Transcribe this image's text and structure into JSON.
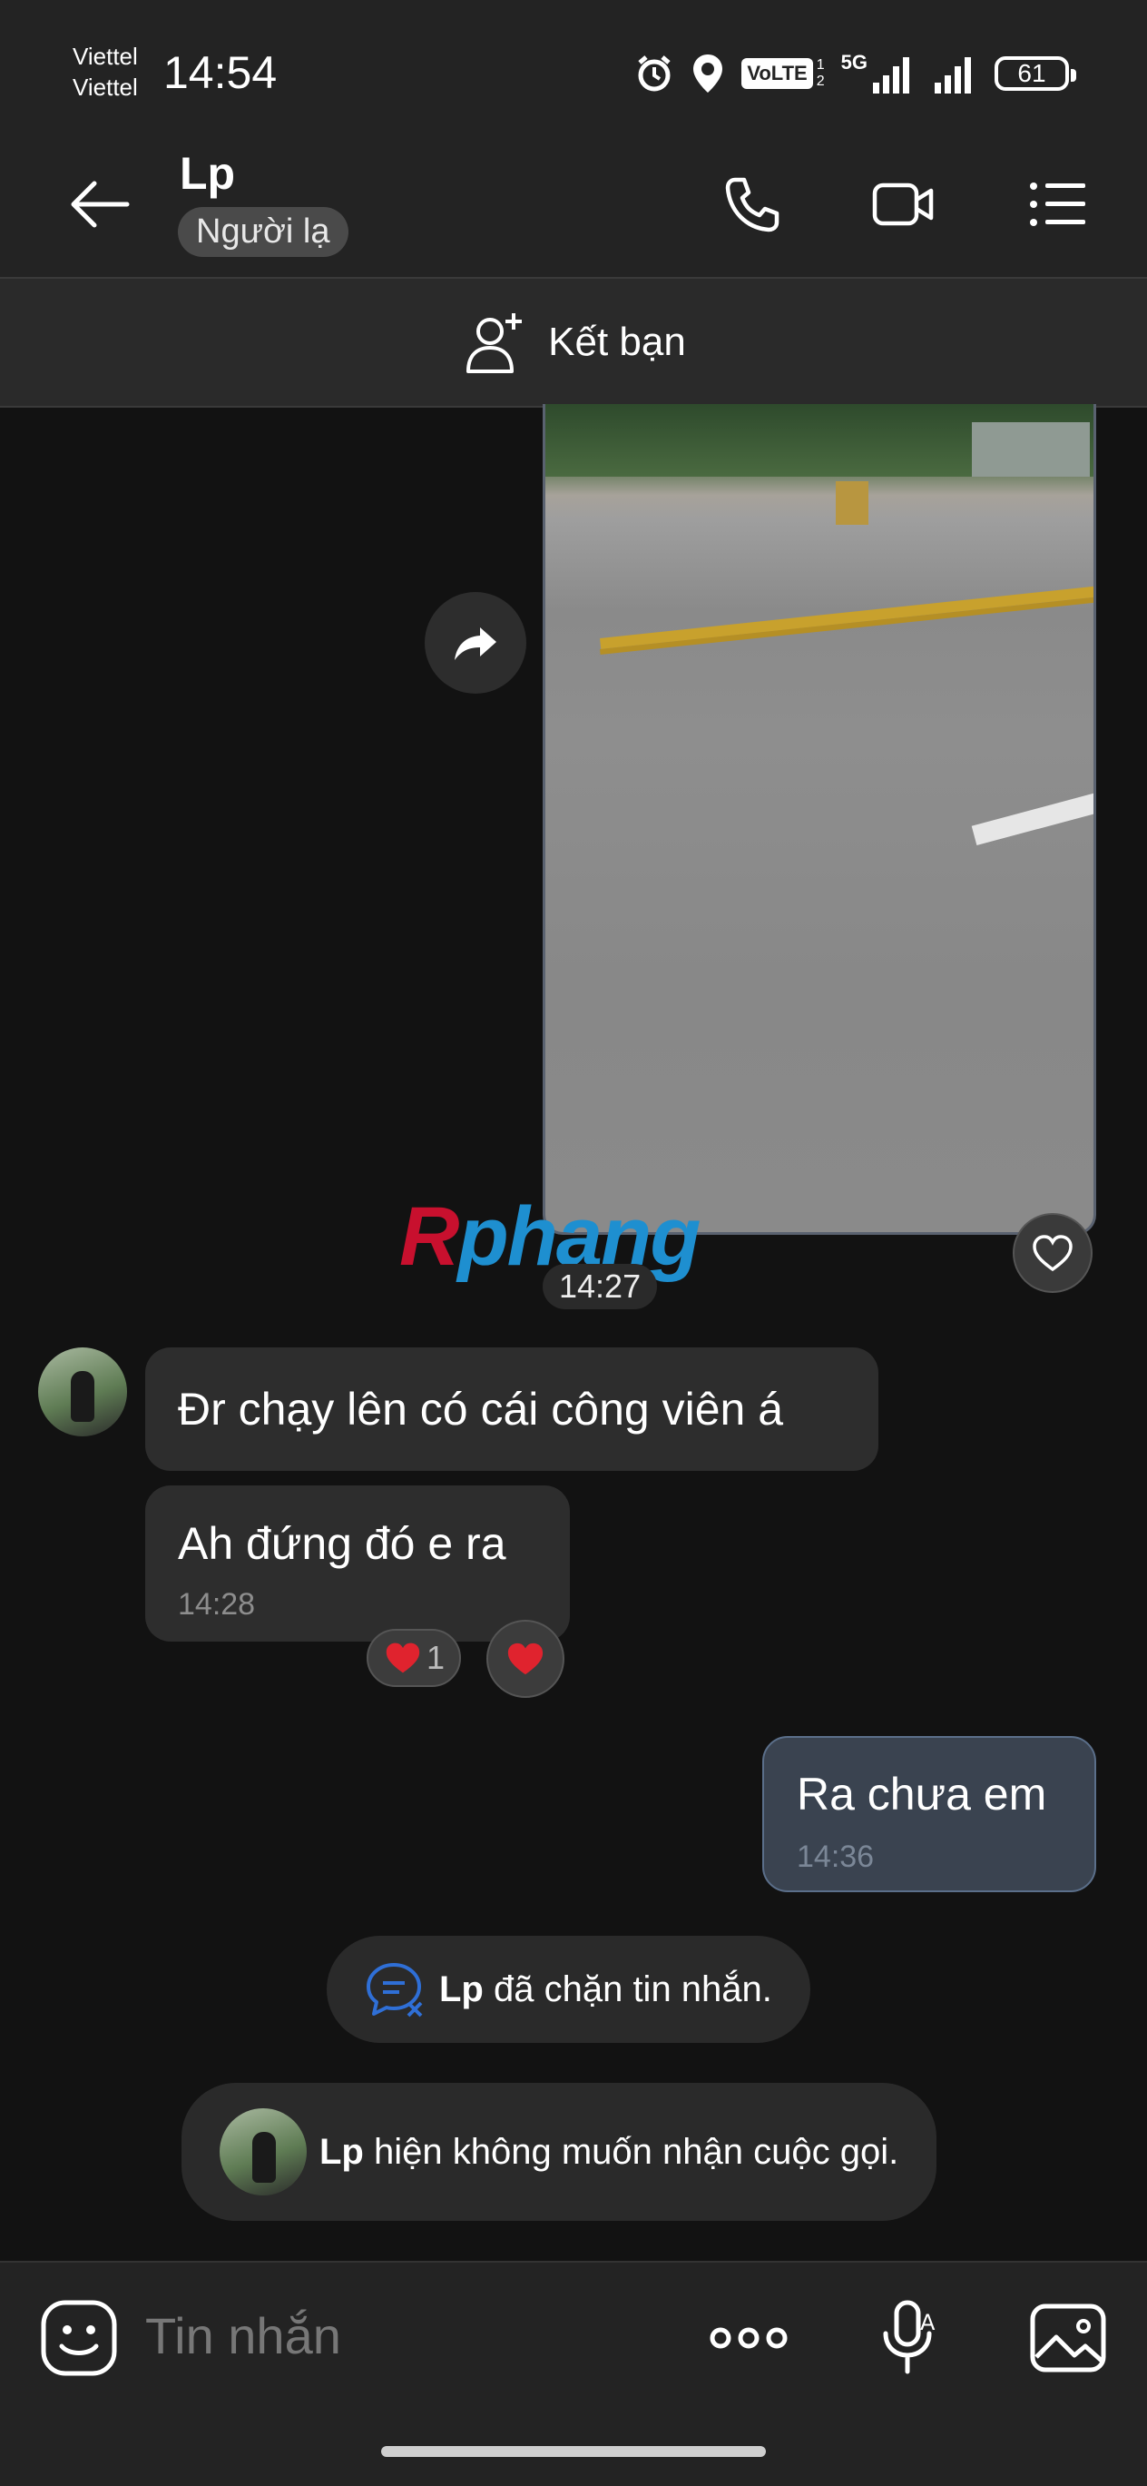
{
  "status_bar": {
    "carrier_1": "Viettel",
    "carrier_2": "Viettel",
    "time": "14:54",
    "network_label": "VoLTE",
    "sim_numbers": [
      "1",
      "2"
    ],
    "network_type": "5G",
    "battery": "61",
    "icons": [
      "alarm-icon",
      "location-icon",
      "signal-icon",
      "battery-icon"
    ]
  },
  "header": {
    "contact_name": "Lp",
    "stranger_badge": "Người lạ",
    "icons": [
      "back-arrow-icon",
      "phone-icon",
      "video-call-icon",
      "menu-list-icon"
    ]
  },
  "friend_bar": {
    "label": "Kết bạn",
    "icon": "add-friend-icon"
  },
  "video_message": {
    "time": "14:27",
    "watermark_r": "R",
    "watermark_rest": "phang"
  },
  "messages": [
    {
      "direction": "in",
      "text": "Đr chạy lên có cái công viên á"
    },
    {
      "direction": "in",
      "text": "Ah đứng đó e ra",
      "time": "14:28",
      "reaction_count": "1"
    },
    {
      "direction": "out",
      "text": "Ra chưa em",
      "time": "14:36"
    }
  ],
  "system_notices": [
    {
      "name": "Lp",
      "text": " đã chặn tin nhắn."
    },
    {
      "name": "Lp",
      "text": " hiện không muốn nhận cuộc gọi."
    }
  ],
  "composer": {
    "placeholder": "Tin nhắn",
    "icons": [
      "sticker-icon",
      "more-icon",
      "voice-icon",
      "image-icon"
    ]
  },
  "colors": {
    "background": "#121212",
    "header": "#232323",
    "bubble_in": "#2d2d2d",
    "bubble_out": "#3a4350",
    "accent_blue": "#1e8fd0"
  }
}
